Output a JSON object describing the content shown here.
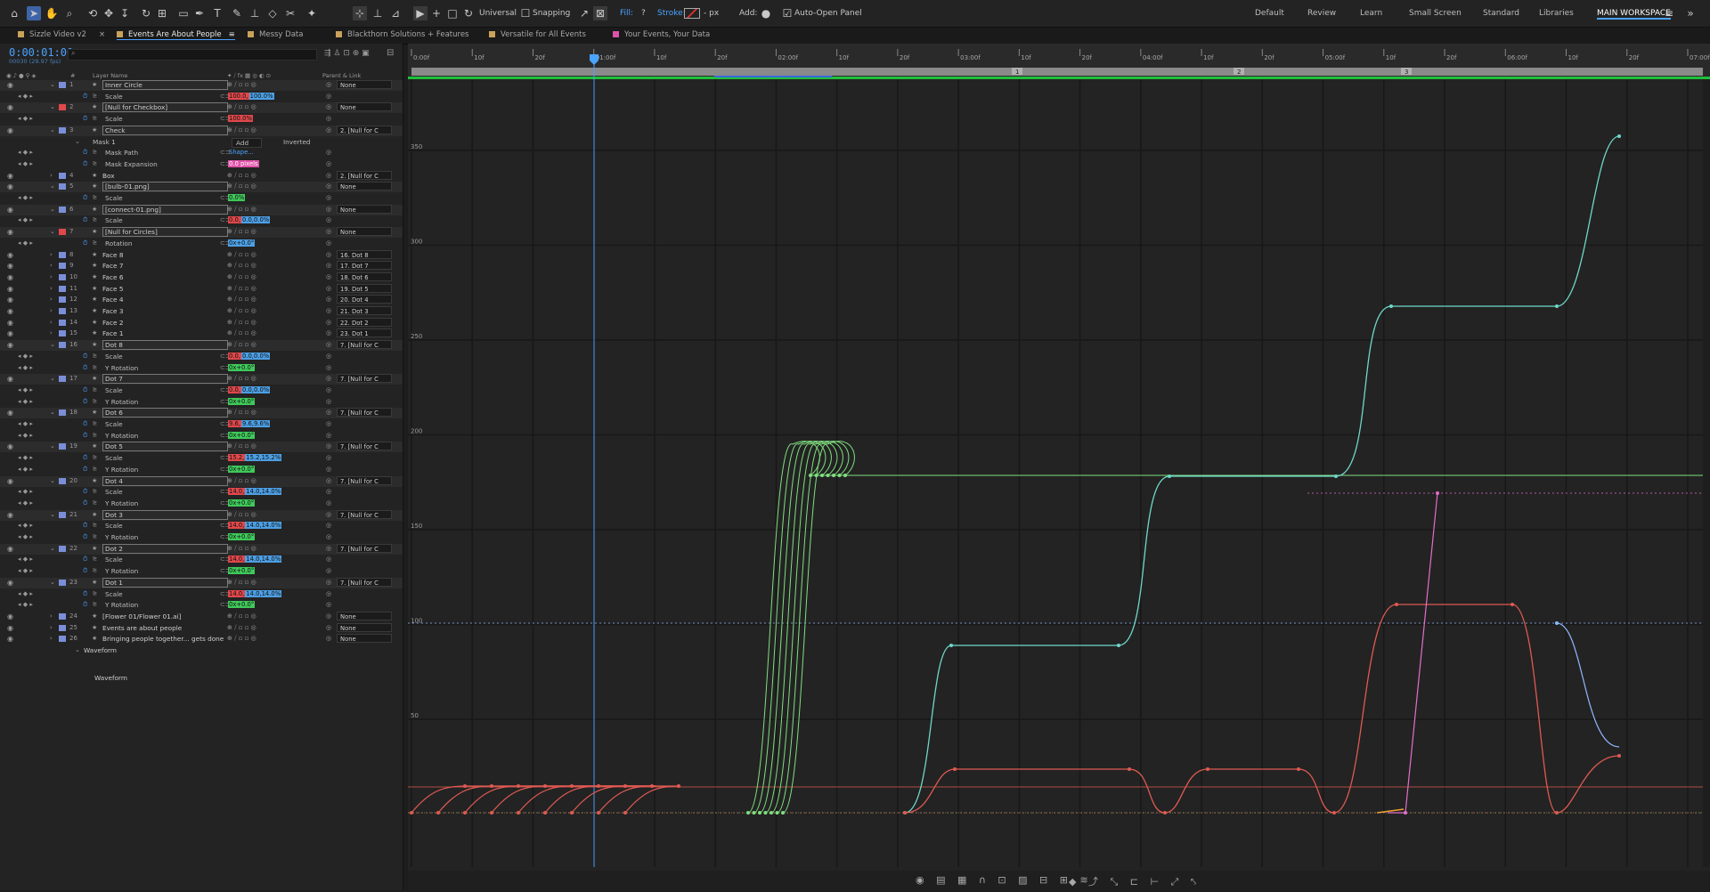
{
  "toolbar": {
    "universal": "Universal",
    "snapping": "Snapping",
    "fill": "Fill:",
    "fill_value": "?",
    "stroke": "Stroke:",
    "stroke_unit": "- px",
    "add": "Add:",
    "auto_open": "Auto-Open Panel",
    "workspaces": [
      "Default",
      "Review",
      "Learn",
      "Small Screen",
      "Standard",
      "Libraries",
      "MAIN WORKSPACE"
    ]
  },
  "tabs": [
    {
      "label": "Sizzle Video v2",
      "color": "#c9a15a"
    },
    {
      "label": "Events Are About People",
      "color": "#c9a15a"
    },
    {
      "label": "Messy Data",
      "color": "#c9a15a"
    },
    {
      "label": "Blackthorn Solutions + Features",
      "color": "#c9a15a"
    },
    {
      "label": "Versatile for All Events",
      "color": "#c9a15a"
    },
    {
      "label": "Your Events, Your Data",
      "color": "#e052a8"
    }
  ],
  "timeline": {
    "timecode": "0:00:01:00",
    "fps": "00030 (29.97 fps)",
    "header_layer_name": "Layer Name",
    "header_parent": "Parent & Link",
    "header_hash": "#"
  },
  "layers": [
    {
      "type": "layer",
      "num": "1",
      "color": "#7a8fd8",
      "name": "Inner Circle",
      "boxed": true,
      "parent": "None"
    },
    {
      "type": "prop",
      "name": "Scale",
      "values": [
        [
          "100.0,",
          "vr"
        ],
        [
          "100.0%",
          "vb"
        ]
      ]
    },
    {
      "type": "layer",
      "num": "2",
      "color": "#e0484b",
      "name": "[Null for Checkbox]",
      "boxed": true,
      "parent": "None"
    },
    {
      "type": "prop",
      "name": "Scale",
      "values": [
        [
          "100.0%",
          "vr"
        ]
      ]
    },
    {
      "type": "layer",
      "num": "3",
      "color": "#7a8fd8",
      "name": "Check",
      "boxed": true,
      "parent": "2. [Null for C"
    },
    {
      "type": "mask",
      "name": "Mask 1",
      "mode": "Add",
      "inverted": "Inverted"
    },
    {
      "type": "prop",
      "name": "Mask Path",
      "values": [
        [
          "Shape...",
          "link"
        ]
      ]
    },
    {
      "type": "prop",
      "name": "Mask Expansion",
      "values": [
        [
          "0.0 pixels",
          "vp"
        ]
      ]
    },
    {
      "type": "layer",
      "num": "4",
      "color": "#7a8fd8",
      "name": "Box",
      "boxed": false,
      "parent": "2. [Null for C"
    },
    {
      "type": "layer",
      "num": "5",
      "color": "#7a8fd8",
      "name": "[bulb-01.png]",
      "boxed": true,
      "parent": "None"
    },
    {
      "type": "prop",
      "name": "Scale",
      "values": [
        [
          "0.0%",
          "vg"
        ]
      ]
    },
    {
      "type": "layer",
      "num": "6",
      "color": "#7a8fd8",
      "name": "[connect-01.png]",
      "boxed": true,
      "parent": "None"
    },
    {
      "type": "prop",
      "name": "Scale",
      "values": [
        [
          "0.0,",
          "vr"
        ],
        [
          "0.0,0.0%",
          "vb"
        ]
      ]
    },
    {
      "type": "layer",
      "num": "7",
      "color": "#e0484b",
      "name": "[Null for Circles]",
      "boxed": true,
      "parent": "None"
    },
    {
      "type": "prop",
      "name": "Rotation",
      "values": [
        [
          "0x+0.0°",
          "vb"
        ]
      ]
    },
    {
      "type": "layer",
      "num": "8",
      "color": "#7a8fd8",
      "name": "Face 8",
      "parent": "16. Dot 8"
    },
    {
      "type": "layer",
      "num": "9",
      "color": "#7a8fd8",
      "name": "Face 7",
      "parent": "17. Dot 7"
    },
    {
      "type": "layer",
      "num": "10",
      "color": "#7a8fd8",
      "name": "Face 6",
      "parent": "18. Dot 6"
    },
    {
      "type": "layer",
      "num": "11",
      "color": "#7a8fd8",
      "name": "Face 5",
      "parent": "19. Dot 5"
    },
    {
      "type": "layer",
      "num": "12",
      "color": "#7a8fd8",
      "name": "Face 4",
      "parent": "20. Dot 4"
    },
    {
      "type": "layer",
      "num": "13",
      "color": "#7a8fd8",
      "name": "Face 3",
      "parent": "21. Dot 3"
    },
    {
      "type": "layer",
      "num": "14",
      "color": "#7a8fd8",
      "name": "Face 2",
      "parent": "22. Dot 2"
    },
    {
      "type": "layer",
      "num": "15",
      "color": "#7a8fd8",
      "name": "Face 1",
      "parent": "23. Dot 1"
    },
    {
      "type": "layer",
      "num": "16",
      "color": "#7a8fd8",
      "name": "Dot 8",
      "boxed": true,
      "parent": "7. [Null for C"
    },
    {
      "type": "prop",
      "name": "Scale",
      "values": [
        [
          "0.0,",
          "vr"
        ],
        [
          "0.0,0.0%",
          "vb"
        ]
      ]
    },
    {
      "type": "prop",
      "name": "Y Rotation",
      "values": [
        [
          "0x+0.0°",
          "vg"
        ]
      ]
    },
    {
      "type": "layer",
      "num": "17",
      "color": "#7a8fd8",
      "name": "Dot 7",
      "boxed": true,
      "parent": "7. [Null for C"
    },
    {
      "type": "prop",
      "name": "Scale",
      "values": [
        [
          "0.0,",
          "vr"
        ],
        [
          "0.0,0.0%",
          "vb"
        ]
      ]
    },
    {
      "type": "prop",
      "name": "Y Rotation",
      "values": [
        [
          "0x+0.0°",
          "vg"
        ]
      ]
    },
    {
      "type": "layer",
      "num": "18",
      "color": "#7a8fd8",
      "name": "Dot 6",
      "boxed": true,
      "parent": "7. [Null for C"
    },
    {
      "type": "prop",
      "name": "Scale",
      "values": [
        [
          "9.6,",
          "vr"
        ],
        [
          "9.6,9.6%",
          "vb"
        ]
      ]
    },
    {
      "type": "prop",
      "name": "Y Rotation",
      "values": [
        [
          "0x+0.0°",
          "vg"
        ]
      ]
    },
    {
      "type": "layer",
      "num": "19",
      "color": "#7a8fd8",
      "name": "Dot 5",
      "boxed": true,
      "parent": "7. [Null for C"
    },
    {
      "type": "prop",
      "name": "Scale",
      "values": [
        [
          "15.2,",
          "vr"
        ],
        [
          "15.2,15.2%",
          "vb"
        ]
      ]
    },
    {
      "type": "prop",
      "name": "Y Rotation",
      "values": [
        [
          "0x+0.0°",
          "vg"
        ]
      ]
    },
    {
      "type": "layer",
      "num": "20",
      "color": "#7a8fd8",
      "name": "Dot 4",
      "boxed": true,
      "parent": "7. [Null for C"
    },
    {
      "type": "prop",
      "name": "Scale",
      "values": [
        [
          "14.0,",
          "vr"
        ],
        [
          "14.0,14.0%",
          "vb"
        ]
      ]
    },
    {
      "type": "prop",
      "name": "Y Rotation",
      "values": [
        [
          "0x+0.0°",
          "vg"
        ]
      ]
    },
    {
      "type": "layer",
      "num": "21",
      "color": "#7a8fd8",
      "name": "Dot 3",
      "boxed": true,
      "parent": "7. [Null for C"
    },
    {
      "type": "prop",
      "name": "Scale",
      "values": [
        [
          "14.0,",
          "vr"
        ],
        [
          "14.0,14.0%",
          "vb"
        ]
      ]
    },
    {
      "type": "prop",
      "name": "Y Rotation",
      "values": [
        [
          "0x+0.0°",
          "vg"
        ]
      ]
    },
    {
      "type": "layer",
      "num": "22",
      "color": "#7a8fd8",
      "name": "Dot 2",
      "boxed": true,
      "parent": "7. [Null for C"
    },
    {
      "type": "prop",
      "name": "Scale",
      "values": [
        [
          "14.0,",
          "vr"
        ],
        [
          "14.0,14.0%",
          "vb"
        ]
      ]
    },
    {
      "type": "prop",
      "name": "Y Rotation",
      "values": [
        [
          "0x+0.0°",
          "vg"
        ]
      ]
    },
    {
      "type": "layer",
      "num": "23",
      "color": "#7a8fd8",
      "name": "Dot 1",
      "boxed": true,
      "parent": "7. [Null for C"
    },
    {
      "type": "prop",
      "name": "Scale",
      "values": [
        [
          "14.0,",
          "vr"
        ],
        [
          "14.0,14.0%",
          "vb"
        ]
      ]
    },
    {
      "type": "prop",
      "name": "Y Rotation",
      "values": [
        [
          "0x+0.0°",
          "vg"
        ]
      ]
    },
    {
      "type": "layer",
      "num": "24",
      "color": "#7a8fd8",
      "name": "[Flower 01/Flower 01.ai]",
      "boxed": false,
      "parent": "None"
    },
    {
      "type": "layer",
      "num": "25",
      "color": "#7a8fd8",
      "name": "Events are about people",
      "boxed": false,
      "parent": "None"
    },
    {
      "type": "layer",
      "num": "26",
      "color": "#7a8fd8",
      "name": "Bringing people together... gets done",
      "boxed": false,
      "parent": "None"
    },
    {
      "type": "group",
      "name": "Waveform"
    },
    {
      "type": "plain",
      "name": "Waveform"
    }
  ],
  "ruler": [
    "0:00f",
    "10f",
    "20f",
    "01:00f",
    "10f",
    "20f",
    "02:00f",
    "10f",
    "20f",
    "03:00f",
    "10f",
    "20f",
    "04:00f",
    "10f",
    "20f",
    "05:00f",
    "10f",
    "20f",
    "06:00f",
    "10f",
    "20f",
    "07:00f"
  ],
  "markers": [
    "1",
    "2",
    "3"
  ],
  "graph_axis": [
    "350",
    "300",
    "250",
    "200",
    "150",
    "100",
    "50"
  ],
  "colors": {
    "accent": "#4aa3ff",
    "red": "#e05a52",
    "green": "#7fe07f",
    "cyan": "#6ed8c9",
    "pink": "#e56ecb",
    "blue": "#8fb8ff"
  }
}
